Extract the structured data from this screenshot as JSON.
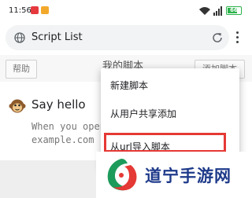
{
  "status_bar": {
    "time": "11:56",
    "battery": "66"
  },
  "browser": {
    "url_text": "Script List",
    "icons": {
      "site": "globe-icon",
      "reload": "reload-icon",
      "menu": "more-vert-icon"
    }
  },
  "page": {
    "title": "我的脚本",
    "help_label": "帮助",
    "add_label": "添加脚本"
  },
  "script": {
    "name": "Say hello",
    "description": "When you open\nexample.com"
  },
  "dropdown": {
    "items": [
      {
        "label": "新建脚本"
      },
      {
        "label": "从用户共享添加"
      },
      {
        "label": "从url导入脚本"
      }
    ],
    "highlight_color": "#e53935"
  },
  "watermark": {
    "text": "道宁手游网"
  }
}
